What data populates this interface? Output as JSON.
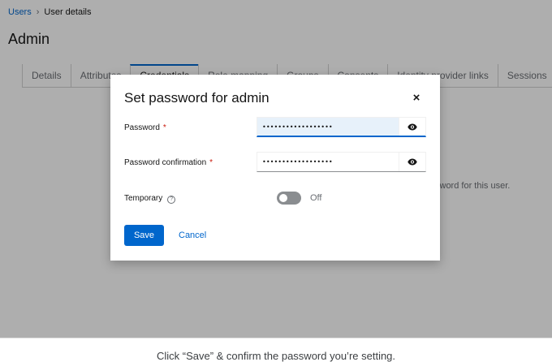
{
  "breadcrumb": {
    "parent": "Users",
    "current": "User details"
  },
  "page": {
    "title": "Admin"
  },
  "tabs": [
    {
      "label": "Details"
    },
    {
      "label": "Attributes"
    },
    {
      "label": "Credentials"
    },
    {
      "label": "Role mapping"
    },
    {
      "label": "Groups"
    },
    {
      "label": "Consents"
    },
    {
      "label": "Identity provider links"
    },
    {
      "label": "Sessions"
    }
  ],
  "background_text": "sword for this user.",
  "modal": {
    "title": "Set password for admin",
    "close_symbol": "×",
    "password_label": "Password",
    "password_value": "••••••••••••••••••",
    "confirm_label": "Password confirmation",
    "confirm_value": "••••••••••••••••••",
    "required_marker": "*",
    "temporary_label": "Temporary",
    "temporary_state": "Off",
    "save_label": "Save",
    "cancel_label": "Cancel"
  },
  "icons": {
    "help": "?",
    "eye": "eye-icon",
    "close": "close-icon"
  },
  "colors": {
    "accent": "#0066cc",
    "required": "#c9190b",
    "focus_bg": "#e7f1fa"
  },
  "caption": "Click “Save” & confirm the password you’re setting."
}
